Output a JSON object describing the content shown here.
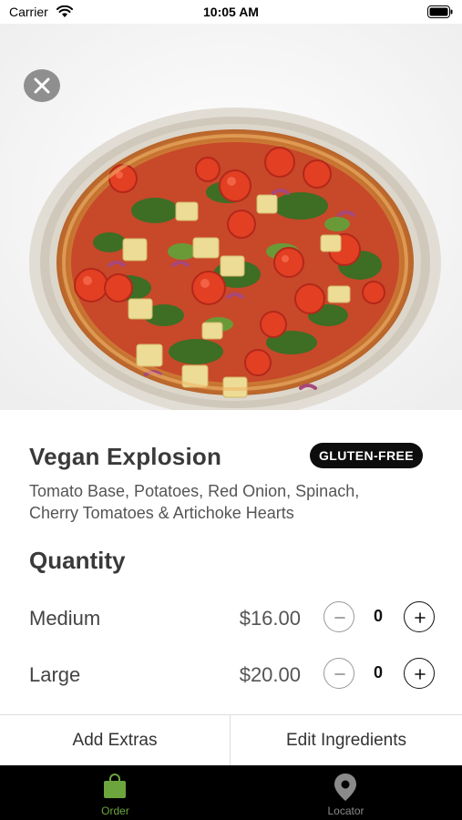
{
  "status_bar": {
    "carrier": "Carrier",
    "time": "10:05 AM"
  },
  "hero": {
    "image_subject": "vegan pizza with spinach, cherry tomatoes, red onion, potatoes and artichoke hearts on a ceramic plate",
    "close_icon": "close-icon"
  },
  "product": {
    "name": "Vegan Explosion",
    "badge": "GLUTEN-FREE",
    "ingredients": "Tomato Base, Potatoes, Red Onion, Spinach, Cherry Tomatoes & Artichoke Hearts"
  },
  "quantity": {
    "heading": "Quantity",
    "sizes": [
      {
        "label": "Medium",
        "price": "$16.00",
        "count": "0"
      },
      {
        "label": "Large",
        "price": "$20.00",
        "count": "0"
      }
    ]
  },
  "actions": {
    "add_extras": "Add Extras",
    "edit_ingredients": "Edit Ingredients"
  },
  "tab_bar": {
    "items": [
      {
        "label": "Order",
        "icon": "shopping-bag-icon",
        "active": true,
        "color": "#6ca53d"
      },
      {
        "label": "Locator",
        "icon": "location-pin-icon",
        "active": false,
        "color": "#8a8a8a"
      }
    ]
  },
  "colors": {
    "accent": "#6ca53d",
    "badge_bg": "#0d0d0d",
    "tab_bar_bg": "#000000"
  }
}
